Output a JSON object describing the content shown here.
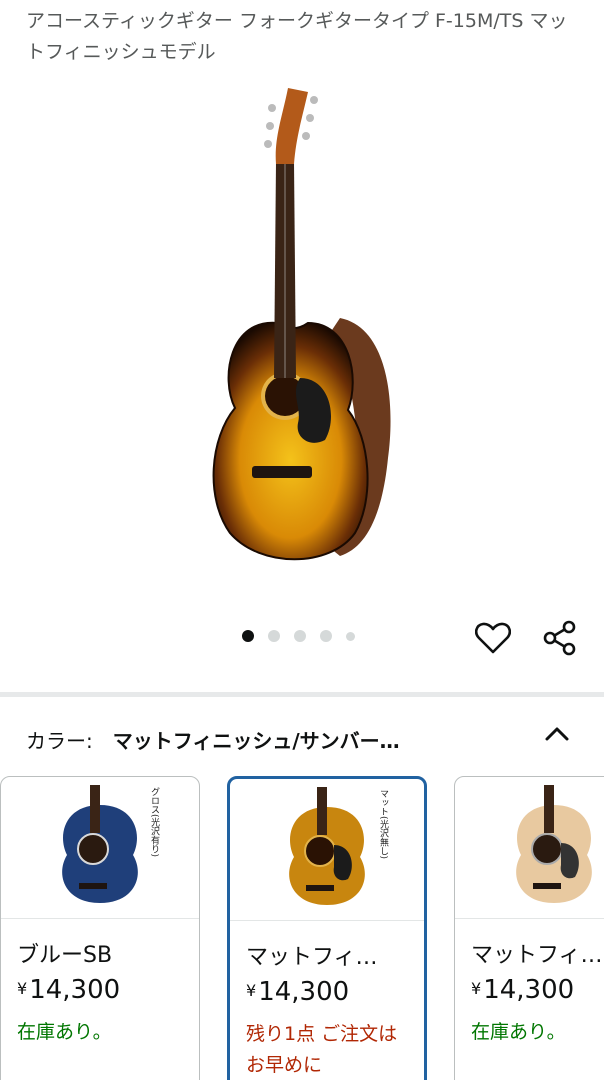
{
  "product": {
    "title": "アコースティックギター フォークギタータイプ F-15M/TS マットフィニッシュモデル"
  },
  "gallery": {
    "dot_count": 5,
    "active_index": 0
  },
  "actions": {
    "wishlist_icon": "heart-icon",
    "share_icon": "share-icon"
  },
  "variation": {
    "label": "カラー:",
    "selected_value": "マットフィニッシュ/サンバー…",
    "toggle_icon": "chevron-up-icon"
  },
  "swatches": [
    {
      "name": "ブルーSB",
      "currency": "¥",
      "price": "14,300",
      "stock": "在庫あり。",
      "tag": "グロス(光沢有り)",
      "selected": false,
      "color": "#1f3f7a"
    },
    {
      "name": "マットフィ…",
      "currency": "¥",
      "price": "14,300",
      "stock": "残り1点 ご注文はお早めに",
      "tag": "マット(光沢無し)",
      "selected": true,
      "color": "#c8860f"
    },
    {
      "name": "マットフィ…",
      "currency": "¥",
      "price": "14,300",
      "stock": "在庫あり。",
      "selected": false,
      "color": "#e8c9a0"
    }
  ],
  "colors": {
    "in_stock": "#007600",
    "low_stock": "#b12704",
    "selected_border": "#2162a1"
  }
}
